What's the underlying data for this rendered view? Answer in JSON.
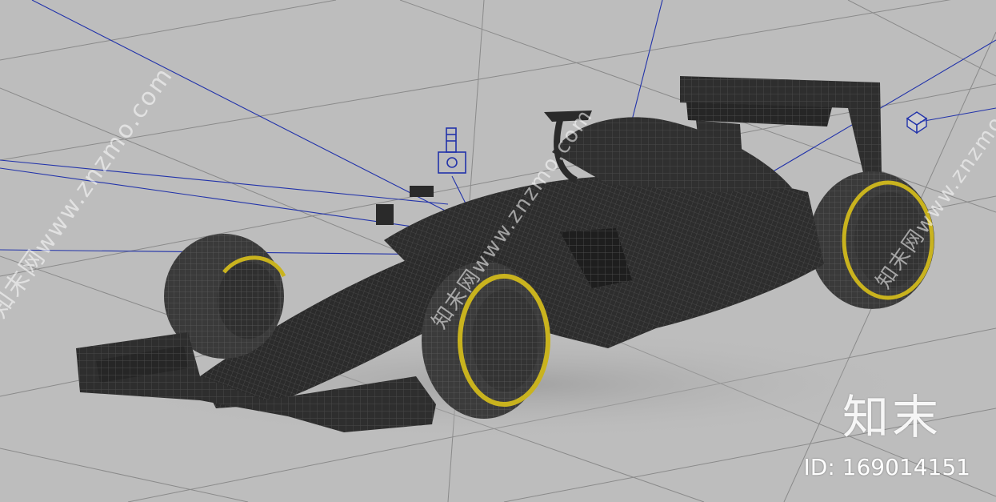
{
  "viewport": {
    "background_color": "#bdbdbd",
    "grid_color": "#8a8a8a",
    "helper_line_color": "#2233aa",
    "wire_color": "#3a3a3a",
    "body_color": "#2d2d2d",
    "tire_stripe_color": "#c9b31e"
  },
  "watermark": {
    "diagonal_text": "知末网www.znzmo.com",
    "logo_text": "知末",
    "image_id": "ID: 169014151"
  },
  "objects": {
    "camera_icon": "camera-icon",
    "light_icon": "light-cube-icon",
    "car": "f1-car-wireframe"
  }
}
